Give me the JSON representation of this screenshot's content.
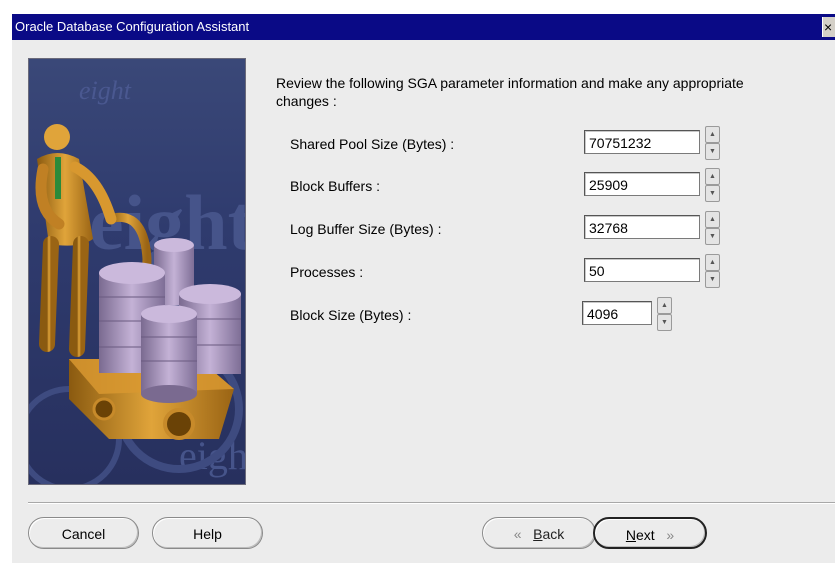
{
  "window": {
    "title": "Oracle Database Configuration Assistant",
    "close_glyph": "×"
  },
  "illustration": {
    "watermark_words": [
      "eight",
      "eight",
      "eigh"
    ]
  },
  "instructions": "Review the following SGA parameter information and make any appropriate changes :",
  "parameters": [
    {
      "label": "Shared Pool Size (Bytes) :",
      "value": "70751232"
    },
    {
      "label": "Block Buffers :",
      "value": "25909"
    },
    {
      "label": "Log Buffer Size (Bytes) :",
      "value": "32768"
    },
    {
      "label": "Processes :",
      "value": "50"
    },
    {
      "label": "Block Size (Bytes) :",
      "value": "4096"
    }
  ],
  "spinner": {
    "up_glyph": "▲",
    "down_glyph": "▼"
  },
  "buttons": {
    "cancel": "Cancel",
    "help": "Help",
    "back_arrow": "«",
    "back_mnemonic": "B",
    "back_rest": "ack",
    "next_mnemonic": "N",
    "next_rest": "ext",
    "next_arrow": "»"
  }
}
